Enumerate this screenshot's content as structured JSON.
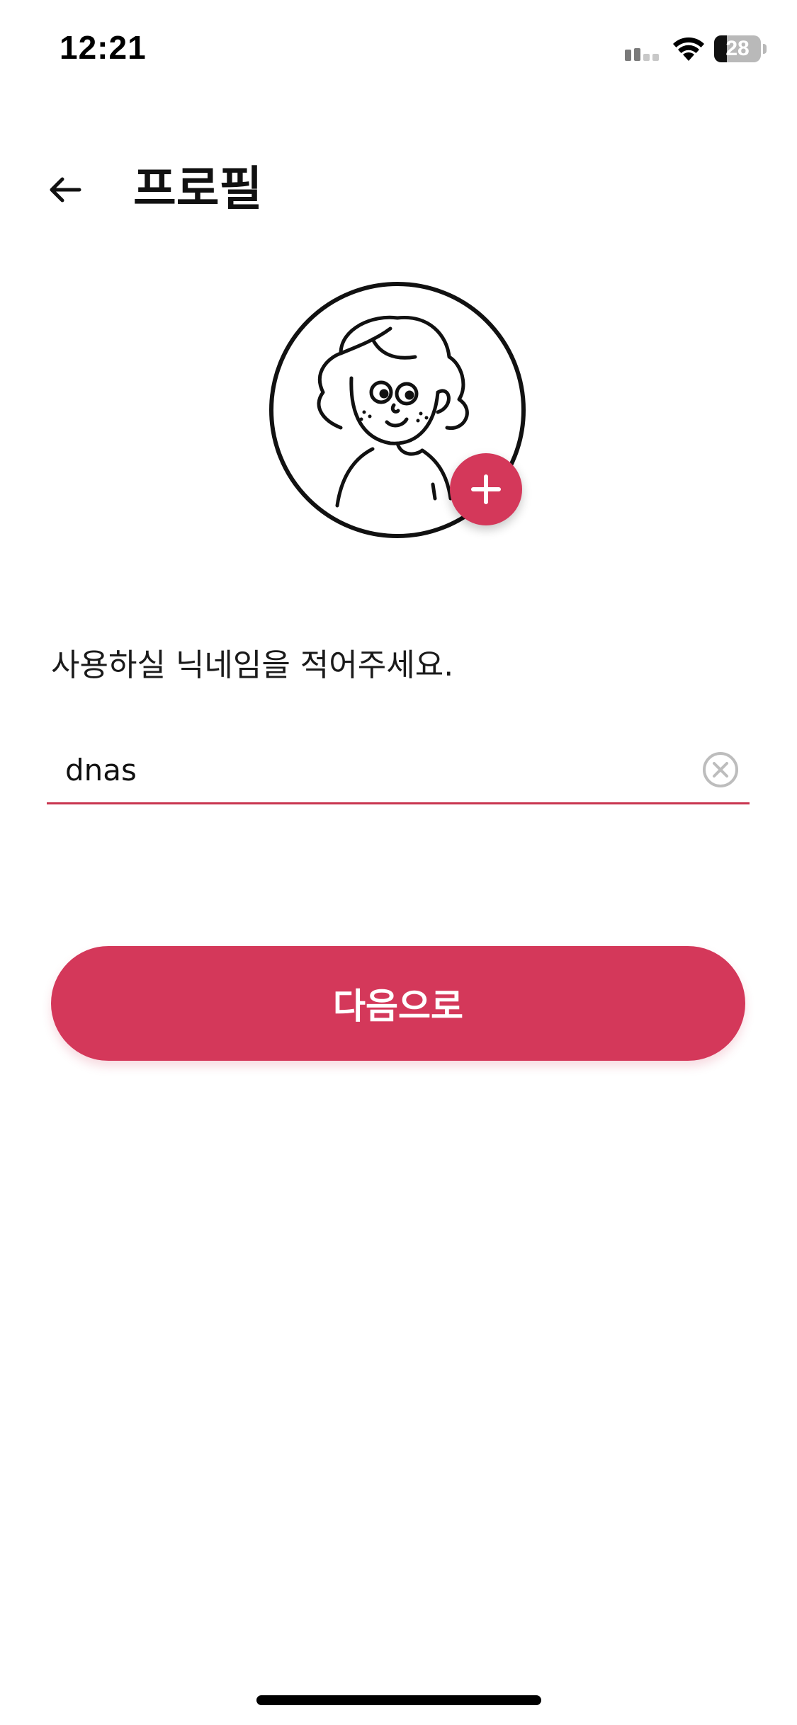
{
  "status_bar": {
    "time": "12:21",
    "battery_level": 28,
    "battery_text": "28",
    "icons": [
      "cellular-signal-icon",
      "wifi-icon",
      "battery-icon"
    ]
  },
  "header": {
    "back_icon": "arrow-left-icon",
    "title": "프로필"
  },
  "avatar": {
    "image": "cartoon-girl-illustration",
    "add_icon": "plus-icon"
  },
  "form": {
    "label": "사용하실 닉네임을 적어주세요.",
    "nickname_value": "dnas",
    "clear_icon": "clear-circle-icon"
  },
  "actions": {
    "next_label": "다음으로"
  },
  "colors": {
    "accent": "#d4385a",
    "text": "#111111",
    "background": "#ffffff"
  }
}
